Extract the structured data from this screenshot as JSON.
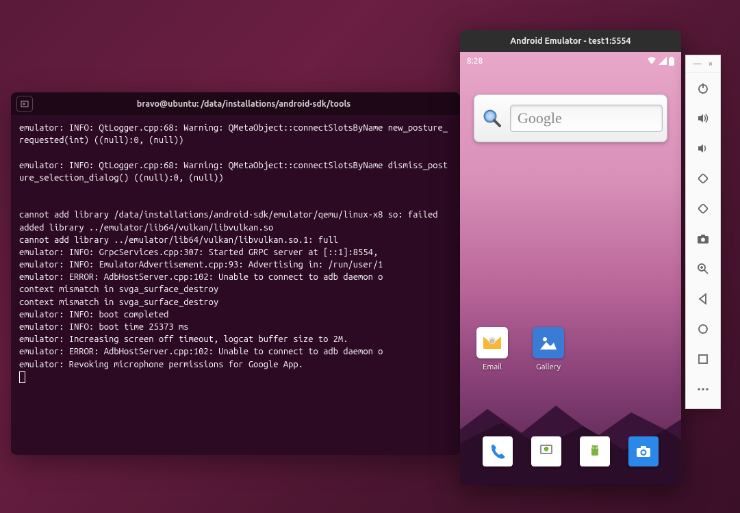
{
  "terminal": {
    "title": "bravo@ubuntu: /data/installations/android-sdk/tools",
    "lines": [
      "emulator: INFO: QtLogger.cpp:68: Warning: QMetaObject::connectSlotsByName new_posture_requested(int) ((null):0, (null))",
      "",
      "emulator: INFO: QtLogger.cpp:68: Warning: QMetaObject::connectSlotsByName dismiss_posture_selection_dialog() ((null):0, (null))",
      "",
      "",
      "cannot add library /data/installations/android-sdk/emulator/qemu/linux-x8 so: failed",
      "added library ../emulator/lib64/vulkan/libvulkan.so",
      "cannot add library ../emulator/lib64/vulkan/libvulkan.so.1: full",
      "emulator: INFO: GrpcServices.cpp:307: Started GRPC server at [::1]:8554,",
      "emulator: INFO: EmulatorAdvertisement.cpp:93: Advertising in: /run/user/1",
      "emulator: ERROR: AdbHostServer.cpp:102: Unable to connect to adb daemon o",
      "context mismatch in svga_surface_destroy",
      "context mismatch in svga_surface_destroy",
      "emulator: INFO: boot completed",
      "emulator: INFO: boot time 25373 ms",
      "emulator: Increasing screen off timeout, logcat buffer size to 2M.",
      "emulator: ERROR: AdbHostServer.cpp:102: Unable to connect to adb daemon o",
      "emulator: Revoking microphone permissions for Google App."
    ]
  },
  "emulator": {
    "title": "Android Emulator - test1:5554",
    "clock": "8:28",
    "search_placeholder": "Google",
    "user_apps": [
      {
        "label": "Email"
      },
      {
        "label": "Gallery"
      }
    ],
    "fav_apps": [
      {
        "name": "phone"
      },
      {
        "name": "messages"
      },
      {
        "name": "android"
      },
      {
        "name": "camera"
      }
    ]
  },
  "sidebar": {
    "minimize": "—",
    "close": "×"
  }
}
